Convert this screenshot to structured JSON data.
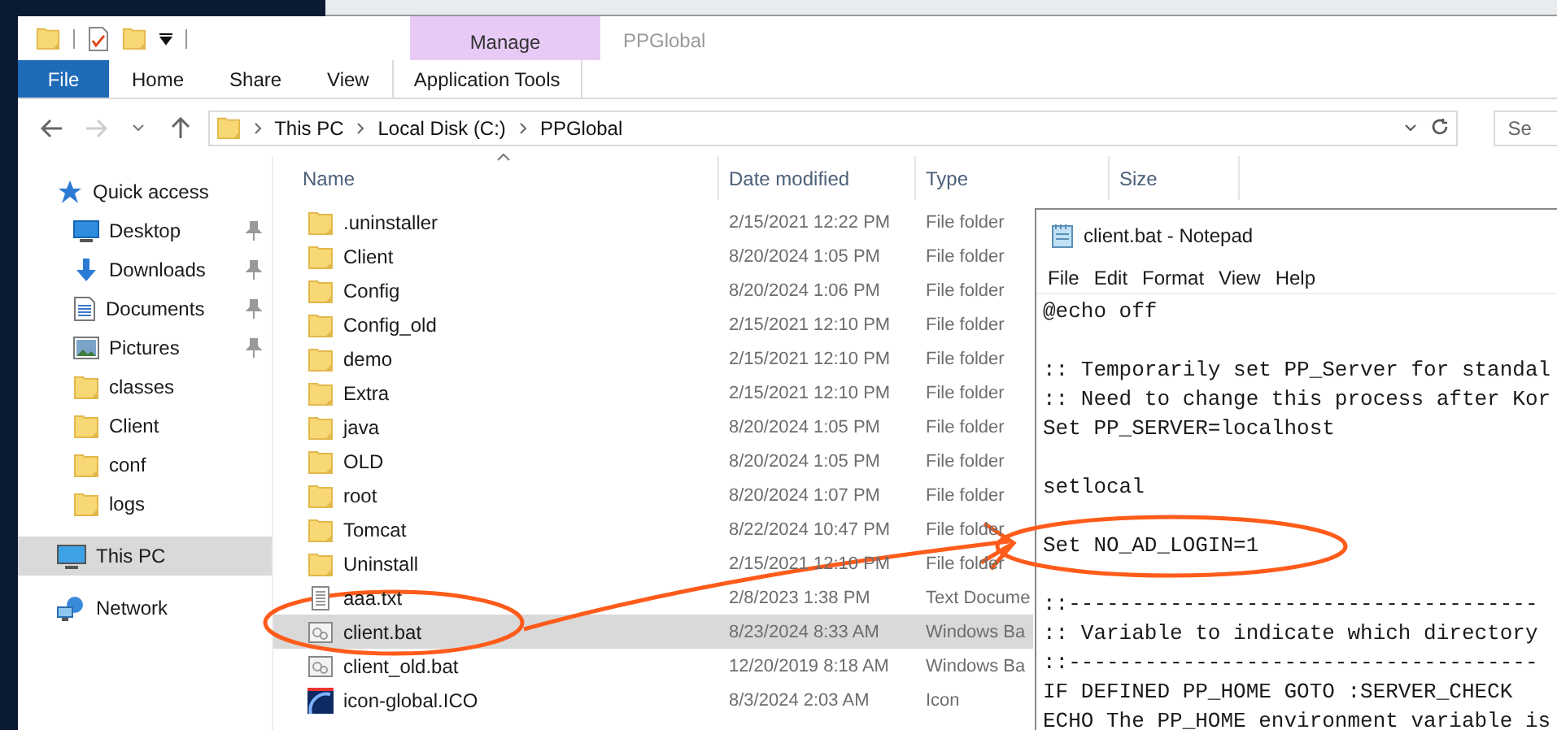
{
  "window": {
    "title": "PPGlobal"
  },
  "context_tab_group": {
    "label": "Manage"
  },
  "ribbon_tabs": [
    {
      "label": "File",
      "selected": true,
      "kind": "file"
    },
    {
      "label": "Home",
      "selected": false,
      "kind": "plain"
    },
    {
      "label": "Share",
      "selected": false,
      "kind": "plain"
    },
    {
      "label": "View",
      "selected": false,
      "kind": "plain"
    },
    {
      "label": "Application Tools",
      "selected": false,
      "kind": "context"
    }
  ],
  "address_bar": {
    "crumbs": [
      "This PC",
      "Local Disk (C:)",
      "PPGlobal"
    ]
  },
  "search": {
    "placeholder": "Se"
  },
  "columns": [
    {
      "label": "Name",
      "sorted": true
    },
    {
      "label": "Date modified",
      "sorted": false
    },
    {
      "label": "Type",
      "sorted": false
    },
    {
      "label": "Size",
      "sorted": false
    }
  ],
  "sidebar": {
    "items": [
      {
        "label": "Quick access",
        "kind": "star",
        "pinned": false,
        "selected": false,
        "children": [
          {
            "label": "Desktop",
            "kind": "desktop",
            "pinned": true,
            "selected": false
          },
          {
            "label": "Downloads",
            "kind": "download",
            "pinned": true,
            "selected": false
          },
          {
            "label": "Documents",
            "kind": "document",
            "pinned": true,
            "selected": false
          },
          {
            "label": "Pictures",
            "kind": "pictures",
            "pinned": true,
            "selected": false
          },
          {
            "label": "classes",
            "kind": "folder",
            "pinned": false,
            "selected": false
          },
          {
            "label": "Client",
            "kind": "folder",
            "pinned": false,
            "selected": false
          },
          {
            "label": "conf",
            "kind": "folder",
            "pinned": false,
            "selected": false
          },
          {
            "label": "logs",
            "kind": "folder",
            "pinned": false,
            "selected": false
          }
        ]
      },
      {
        "label": "This PC",
        "kind": "pc",
        "pinned": false,
        "selected": true
      },
      {
        "label": "Network",
        "kind": "network",
        "pinned": false,
        "selected": false
      }
    ]
  },
  "files": [
    {
      "name": ".uninstaller",
      "date": "2/15/2021 12:22 PM",
      "type": "File folder",
      "kind": "folder",
      "selected": false
    },
    {
      "name": "Client",
      "date": "8/20/2024 1:05 PM",
      "type": "File folder",
      "kind": "folder",
      "selected": false
    },
    {
      "name": "Config",
      "date": "8/20/2024 1:06 PM",
      "type": "File folder",
      "kind": "folder",
      "selected": false
    },
    {
      "name": "Config_old",
      "date": "2/15/2021 12:10 PM",
      "type": "File folder",
      "kind": "folder",
      "selected": false
    },
    {
      "name": "demo",
      "date": "2/15/2021 12:10 PM",
      "type": "File folder",
      "kind": "folder",
      "selected": false
    },
    {
      "name": "Extra",
      "date": "2/15/2021 12:10 PM",
      "type": "File folder",
      "kind": "folder",
      "selected": false
    },
    {
      "name": "java",
      "date": "8/20/2024 1:05 PM",
      "type": "File folder",
      "kind": "folder",
      "selected": false
    },
    {
      "name": "OLD",
      "date": "8/20/2024 1:05 PM",
      "type": "File folder",
      "kind": "folder",
      "selected": false
    },
    {
      "name": "root",
      "date": "8/20/2024 1:07 PM",
      "type": "File folder",
      "kind": "folder",
      "selected": false
    },
    {
      "name": "Tomcat",
      "date": "8/22/2024 10:47 PM",
      "type": "File folder",
      "kind": "folder",
      "selected": false
    },
    {
      "name": "Uninstall",
      "date": "2/15/2021 12:10 PM",
      "type": "File folder",
      "kind": "folder",
      "selected": false
    },
    {
      "name": "aaa.txt",
      "date": "2/8/2023 1:38 PM",
      "type": "Text Docume",
      "kind": "text",
      "selected": false
    },
    {
      "name": "client.bat",
      "date": "8/23/2024 8:33 AM",
      "type": "Windows Ba",
      "kind": "batch",
      "selected": true
    },
    {
      "name": "client_old.bat",
      "date": "12/20/2019 8:18 AM",
      "type": "Windows Ba",
      "kind": "batch",
      "selected": false
    },
    {
      "name": "icon-global.ICO",
      "date": "8/3/2024 2:03 AM",
      "type": "Icon",
      "kind": "image",
      "selected": false
    }
  ],
  "notepad": {
    "title": "client.bat - Notepad",
    "menu": [
      "File",
      "Edit",
      "Format",
      "View",
      "Help"
    ],
    "lines": [
      {
        "text": "@echo off",
        "blank_before": false
      },
      {
        "text": ":: Temporarily set PP_Server for standal",
        "blank_before": true
      },
      {
        "text": ":: Need to change this process after Kor",
        "blank_before": false
      },
      {
        "text": "Set PP_SERVER=localhost",
        "blank_before": false
      },
      {
        "text": "setlocal",
        "blank_before": true
      },
      {
        "text": "Set NO_AD_LOGIN=1",
        "blank_before": true
      },
      {
        "text": "::-------------------------------------",
        "blank_before": true
      },
      {
        "text": ":: Variable to indicate which directory",
        "blank_before": false
      },
      {
        "text": "::-------------------------------------",
        "blank_before": false
      },
      {
        "text": "IF DEFINED PP_HOME GOTO :SERVER_CHECK",
        "blank_before": false
      },
      {
        "text": "ECHO The PP_HOME environment variable is",
        "blank_before": false
      }
    ]
  }
}
